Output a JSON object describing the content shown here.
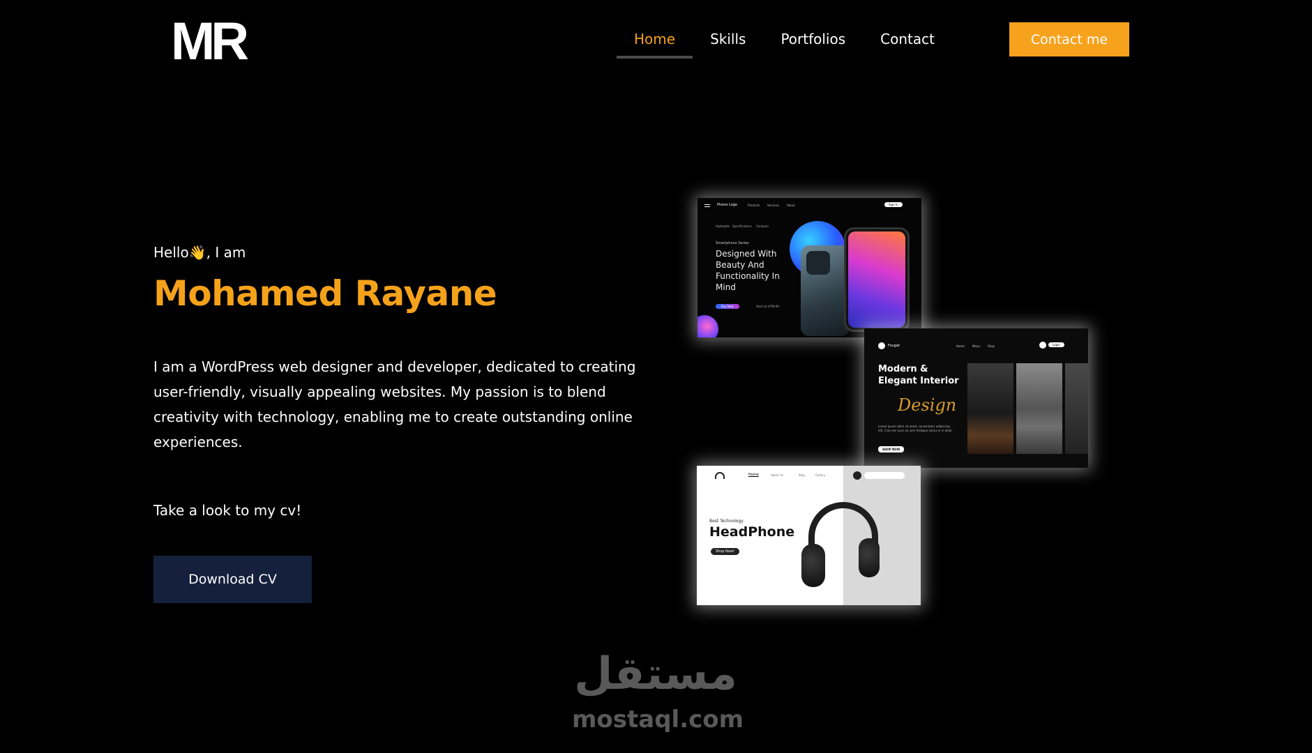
{
  "header": {
    "logo": "MR",
    "nav": [
      {
        "label": "Home",
        "active": true
      },
      {
        "label": "Skills"
      },
      {
        "label": "Portfolios"
      },
      {
        "label": "Contact"
      }
    ],
    "contact_button": "Contact me"
  },
  "hero": {
    "greeting_start": "Hello",
    "greeting_emoji": "👋",
    "greeting_end": ", I am",
    "name": "Mohamed Rayane",
    "description": "I am a WordPress web designer and developer, dedicated to creating user-friendly, visually appealing websites. My passion is to blend creativity with technology, enabling me to create outstanding online experiences.",
    "cv_prompt": "Take a look to my cv!",
    "download_button": "Download CV"
  },
  "portfolio": {
    "phone": {
      "logo": "Phone Logo",
      "nav": [
        "Products",
        "Services",
        "About"
      ],
      "login": "Sign In",
      "tabs": [
        "Highlights",
        "Specifications",
        "Compare"
      ],
      "series": "Smartphone Series",
      "headline": "Designed With Beauty And Functionality In Mind",
      "button": "Buy Now",
      "price": "Start at $799.99"
    },
    "interior": {
      "brand": "Fouget",
      "nav": [
        "Home",
        "Menu",
        "Shop"
      ],
      "login": "Login",
      "headline": "Modern & Elegant Interior",
      "script": "Design",
      "body": "Lorem ipsum dolor sit amet, consectetur adipiscing elit. Cras nec nunc eu sem tristique varius in in dolor.",
      "button": "SHOP NOW"
    },
    "headphone": {
      "nav": [
        "Home",
        "About Us",
        "Blog",
        "Gallery"
      ],
      "eyebrow": "Best Technology",
      "headline": "HeadPhone",
      "button": "Shop Now!"
    }
  },
  "watermark": {
    "arabic": "مستقل",
    "site": "mostaql.com"
  },
  "colors": {
    "accent": "#F5A21B",
    "background": "#000000",
    "cv_button": "#15203D"
  }
}
